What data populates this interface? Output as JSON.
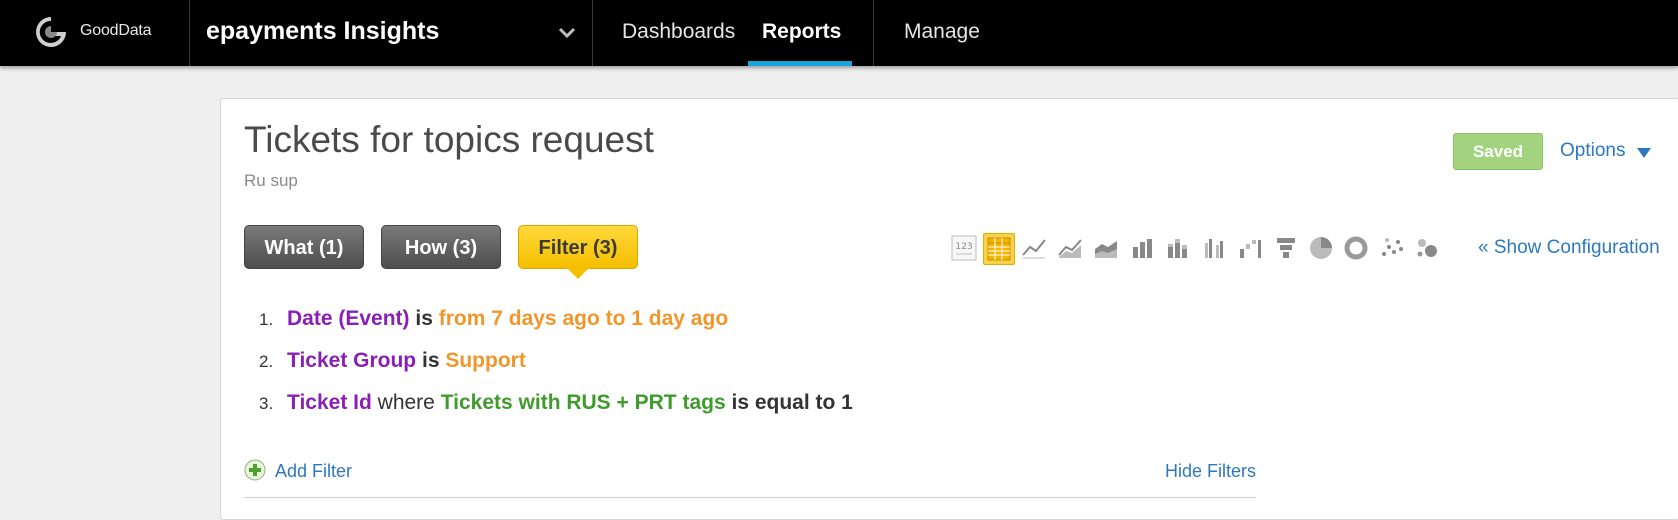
{
  "header": {
    "logo_text": "GoodData",
    "project_name": "epayments Insights",
    "nav": [
      {
        "label": "Dashboards"
      },
      {
        "label": "Reports"
      },
      {
        "label": "Manage"
      }
    ],
    "active_nav": "Reports",
    "accent_color": "#15a5de"
  },
  "report": {
    "title": "Tickets for topics request",
    "subtitle": "Ru sup",
    "saved_label": "Saved",
    "options_label": "Options",
    "tabs": [
      {
        "label": "What (1)"
      },
      {
        "label": "How (3)"
      },
      {
        "label": "Filter (3)"
      }
    ],
    "active_tab": "Filter (3)",
    "viz_icons": [
      "number-icon",
      "table-icon",
      "line-chart-icon",
      "area-line-icon",
      "stacked-area-icon",
      "bar-chart-icon",
      "stacked-bar-icon",
      "grouped-bar-icon",
      "waterfall-icon",
      "funnel-icon",
      "pie-chart-icon",
      "donut-chart-icon",
      "scatter-icon",
      "bubble-icon"
    ],
    "selected_viz": "table-icon",
    "show_config_label": "« Show Configuration"
  },
  "filters": [
    {
      "num": "1.",
      "attr": "Date (Event)",
      "op": "is",
      "value": "from 7 days ago to 1 day ago"
    },
    {
      "num": "2.",
      "attr": "Ticket Group",
      "op": "is",
      "value": "Support"
    },
    {
      "num": "3.",
      "attr": "Ticket Id",
      "where": "where",
      "metric": "Tickets with RUS + PRT tags",
      "condition": "is equal to 1"
    }
  ],
  "filter_actions": {
    "add_label": "Add Filter",
    "hide_label": "Hide Filters"
  }
}
